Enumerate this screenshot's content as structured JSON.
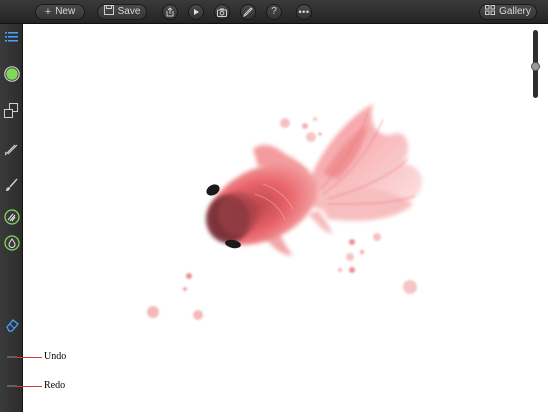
{
  "toolbar": {
    "new_label": "New",
    "save_label": "Save",
    "gallery_label": "Gallery"
  },
  "zoom": {
    "level": 0.55
  },
  "annotations": {
    "undo_label": "Undo",
    "redo_label": "Redo"
  },
  "colors": {
    "current_color": "#7ed957",
    "accent_green": "#7ed957",
    "annotation_red": "#d23a3a",
    "fish_red": "#e85a5a"
  }
}
